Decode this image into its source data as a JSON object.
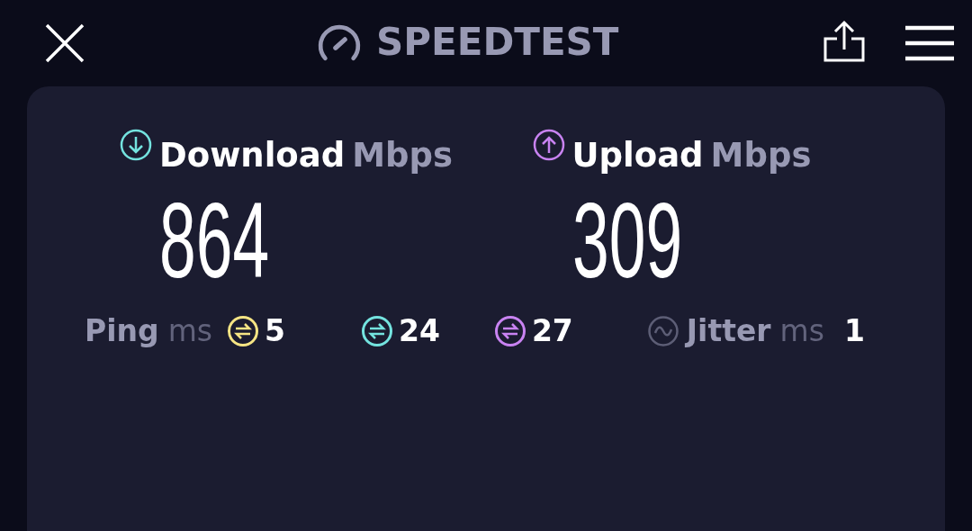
{
  "header": {
    "title": "SPEEDTEST"
  },
  "results": [
    {
      "kind": "download",
      "label": "Download",
      "unit": "Mbps",
      "value": "864",
      "color": "#74e3df"
    },
    {
      "kind": "upload",
      "label": "Upload",
      "unit": "Mbps",
      "value": "309",
      "color": "#c983f2"
    }
  ],
  "latency": {
    "label": "Ping",
    "unit": "ms",
    "readings": [
      {
        "value": "5",
        "color": "#f6e584"
      },
      {
        "value": "24",
        "color": "#74e3df"
      },
      {
        "value": "27",
        "color": "#c983f2"
      }
    ]
  },
  "jitter": {
    "label": "Jitter",
    "unit": "ms",
    "value": "1"
  }
}
